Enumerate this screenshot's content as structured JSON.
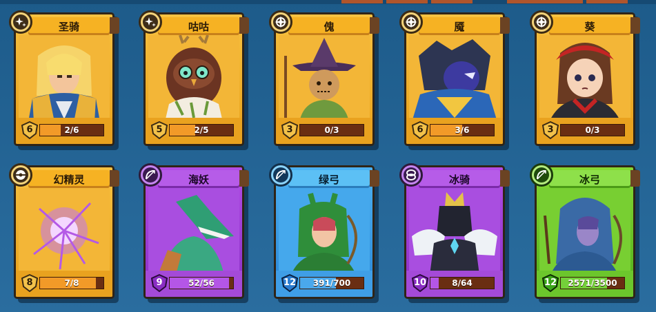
{
  "cards": [
    {
      "name": "圣骑",
      "level": "6",
      "progress": "2/6",
      "fill": 0.33,
      "rarity": "gold",
      "class_icon": "sparkle-plus-icon",
      "portrait": "paladin-portrait"
    },
    {
      "name": "咕咕",
      "level": "5",
      "progress": "2/5",
      "fill": 0.4,
      "rarity": "gold",
      "class_icon": "sparkle-plus-icon",
      "portrait": "owl-portrait"
    },
    {
      "name": "傀",
      "level": "3",
      "progress": "0/3",
      "fill": 0.0,
      "rarity": "gold",
      "class_icon": "diamond-compass-icon",
      "portrait": "scarecrow-portrait"
    },
    {
      "name": "魇",
      "level": "6",
      "progress": "3/6",
      "fill": 0.5,
      "rarity": "gold",
      "class_icon": "diamond-compass-icon",
      "portrait": "nightmare-portrait"
    },
    {
      "name": "葵",
      "level": "3",
      "progress": "0/3",
      "fill": 0.0,
      "rarity": "gold",
      "class_icon": "diamond-compass-icon",
      "portrait": "ninja-girl-portrait"
    },
    {
      "name": "幻精灵",
      "level": "8",
      "progress": "7/8",
      "fill": 0.875,
      "rarity": "gold",
      "class_icon": "orb-icon",
      "portrait": "spirit-orb-portrait"
    },
    {
      "name": "海妖",
      "level": "9",
      "progress": "52/56",
      "fill": 0.93,
      "rarity": "purple",
      "class_icon": "bow-icon",
      "portrait": "shark-portrait"
    },
    {
      "name": "绿弓",
      "level": "12",
      "progress": "391/700",
      "fill": 0.56,
      "rarity": "blue",
      "class_icon": "bow-icon",
      "portrait": "green-archer-portrait"
    },
    {
      "name": "冰骑",
      "level": "10",
      "progress": "8/64",
      "fill": 0.125,
      "rarity": "purple",
      "class_icon": "infinity-ring-icon",
      "portrait": "ice-knight-portrait"
    },
    {
      "name": "冰弓",
      "level": "12",
      "progress": "2571/3500",
      "fill": 0.73,
      "rarity": "green",
      "class_icon": "bow-icon",
      "portrait": "ice-archer-portrait"
    }
  ],
  "colors": {
    "background": "#22618f",
    "gold": "#f7c241",
    "purple": "#b24ce6",
    "blue": "#4cb1f1",
    "green": "#86d832"
  }
}
